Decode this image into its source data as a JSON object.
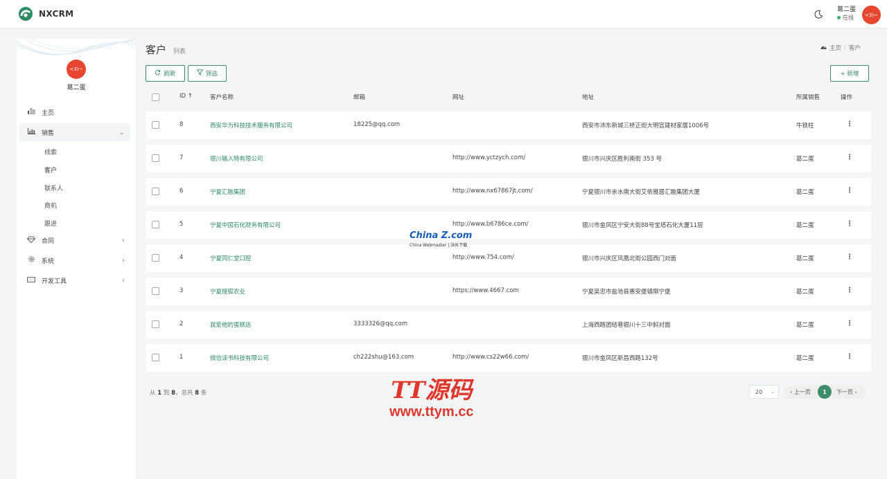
{
  "app": {
    "name": "NXCRM"
  },
  "header": {
    "user_name": "葛二蛋",
    "user_status": "在线",
    "avatar_text": "<3)~"
  },
  "sidebar": {
    "avatar_text": "<3)~",
    "username": "葛二蛋",
    "items": [
      {
        "label": "主页",
        "icon": "bar-chart-icon"
      },
      {
        "label": "销售",
        "icon": "chart-icon",
        "expanded": true
      },
      {
        "label": "合同",
        "icon": "diamond-icon"
      },
      {
        "label": "系统",
        "icon": "gear-icon"
      },
      {
        "label": "开发工具",
        "icon": "keyboard-icon"
      }
    ],
    "sales_sub": [
      "线索",
      "客户",
      "联系人",
      "商机",
      "跟进"
    ]
  },
  "page": {
    "title": "客户",
    "subtitle": "列表"
  },
  "breadcrumb": {
    "home": "主页",
    "sep": "/",
    "current": "客户"
  },
  "toolbar": {
    "refresh": "刷新",
    "filter": "筛选",
    "add": "+ 新增"
  },
  "table": {
    "headers": {
      "id": "ID ↑",
      "name": "客户名称",
      "email": "邮箱",
      "url": "网址",
      "address": "地址",
      "sales": "所属销售",
      "ops": "操作"
    },
    "rows": [
      {
        "id": "8",
        "name": "西安华为科技技术服务有限公司",
        "email": "18225@qq.com",
        "url": "",
        "address": "西安市沛东新城三桥正街大明宫建材家居1006号",
        "sales": "牛铁柱"
      },
      {
        "id": "7",
        "name": "银川输入特有限公司",
        "email": "",
        "url": "http://www.yctzych.com/",
        "address": "银川市兴庆区胜利南街 353 号",
        "sales": "葛二蛋"
      },
      {
        "id": "6",
        "name": "宁夏汇融集团",
        "email": "",
        "url": "http://www.nx67867jt.com/",
        "address": "宁夏银川市亲水南大街艾依雅居汇融集团大厦",
        "sales": "葛二蛋"
      },
      {
        "id": "5",
        "name": "宁夏中国石化财务有限公司",
        "email": "",
        "url": "http://www.b6786ce.com/",
        "address": "银川市金凤区宁安大街88号宝塔石化大厦11层",
        "sales": "葛二蛋"
      },
      {
        "id": "4",
        "name": "宁夏同仁堂口腔",
        "email": "",
        "url": "http://www.754.com/",
        "address": "银川市兴庆区凤凰北街公园西门对面",
        "sales": "葛二蛋"
      },
      {
        "id": "3",
        "name": "宁夏搜狐农业",
        "email": "",
        "url": "https://www.4667.com",
        "address": "宁夏吴忠市盐池县惠安堡镇隰宁堡",
        "sales": "葛二蛋"
      },
      {
        "id": "2",
        "name": "我爱他的蛋糕店",
        "email": "3333326@qq.com",
        "url": "",
        "address": "上海西路团结巷银川十三中斜对面",
        "sales": "葛二蛋"
      },
      {
        "id": "1",
        "name": "微信读书科技有限公司",
        "email": "ch222shu@163.com",
        "url": "http://www.cs22w66.com/",
        "address": "银川市金凤区新昌西路132号",
        "sales": "葛二蛋"
      }
    ]
  },
  "footer": {
    "from_label": "从",
    "from": "1",
    "to_label": "到",
    "to": "8",
    "total_label": "，总共",
    "total": "8",
    "unit": "条"
  },
  "pagination": {
    "page_size": "20",
    "prev": "‹ 上一页",
    "current": "1",
    "next": "下一页 ›"
  },
  "watermarks": {
    "china_big": "China Z.com",
    "china_small": "China Webmaster | 站长下载",
    "tt_big": "TT源码",
    "tt_small": "www.ttym.cc"
  },
  "colors": {
    "accent": "#3f8c6a",
    "avatar": "#e8472f"
  }
}
